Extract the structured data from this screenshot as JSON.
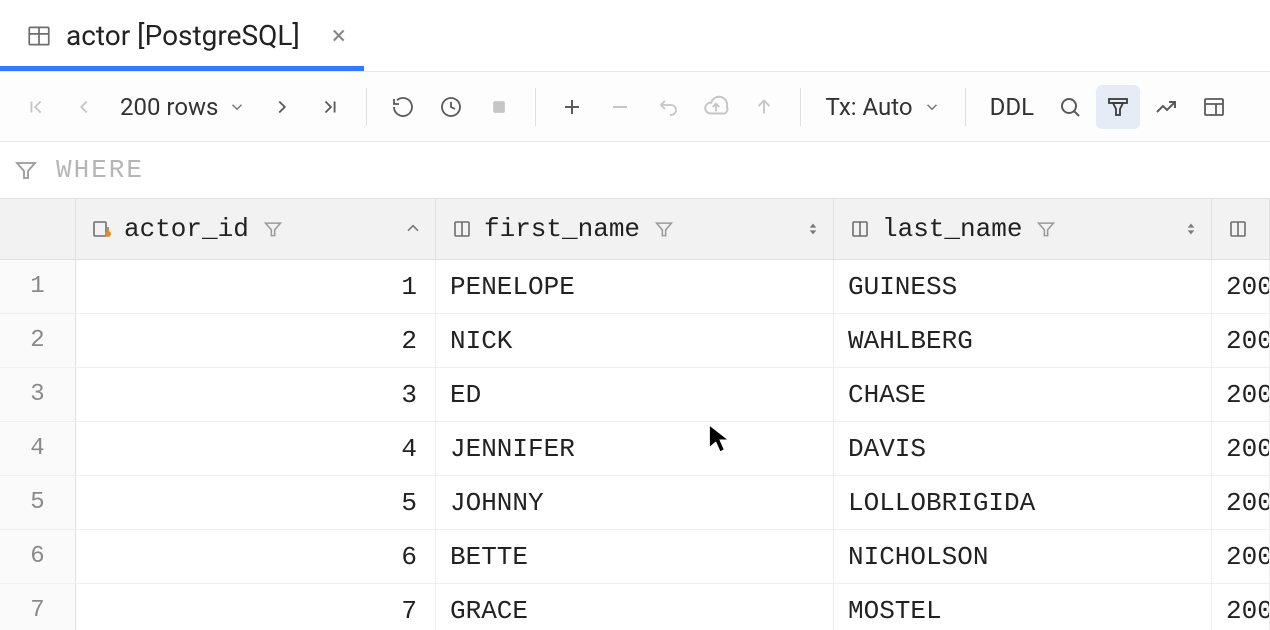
{
  "tab": {
    "title": "actor [PostgreSQL]"
  },
  "toolbar": {
    "rows_label": "200 rows",
    "tx_label": "Tx: Auto",
    "ddl_label": "DDL"
  },
  "where": {
    "label": "WHERE"
  },
  "columns": [
    {
      "name": "actor_id"
    },
    {
      "name": "first_name"
    },
    {
      "name": "last_name"
    }
  ],
  "rows": [
    {
      "n": "1",
      "actor_id": "1",
      "first_name": "PENELOPE",
      "last_name": "GUINESS",
      "c4": "200"
    },
    {
      "n": "2",
      "actor_id": "2",
      "first_name": "NICK",
      "last_name": "WAHLBERG",
      "c4": "200"
    },
    {
      "n": "3",
      "actor_id": "3",
      "first_name": "ED",
      "last_name": "CHASE",
      "c4": "200"
    },
    {
      "n": "4",
      "actor_id": "4",
      "first_name": "JENNIFER",
      "last_name": "DAVIS",
      "c4": "200"
    },
    {
      "n": "5",
      "actor_id": "5",
      "first_name": "JOHNNY",
      "last_name": "LOLLOBRIGIDA",
      "c4": "200"
    },
    {
      "n": "6",
      "actor_id": "6",
      "first_name": "BETTE",
      "last_name": "NICHOLSON",
      "c4": "200"
    },
    {
      "n": "7",
      "actor_id": "7",
      "first_name": "GRACE",
      "last_name": "MOSTEL",
      "c4": "200"
    }
  ]
}
